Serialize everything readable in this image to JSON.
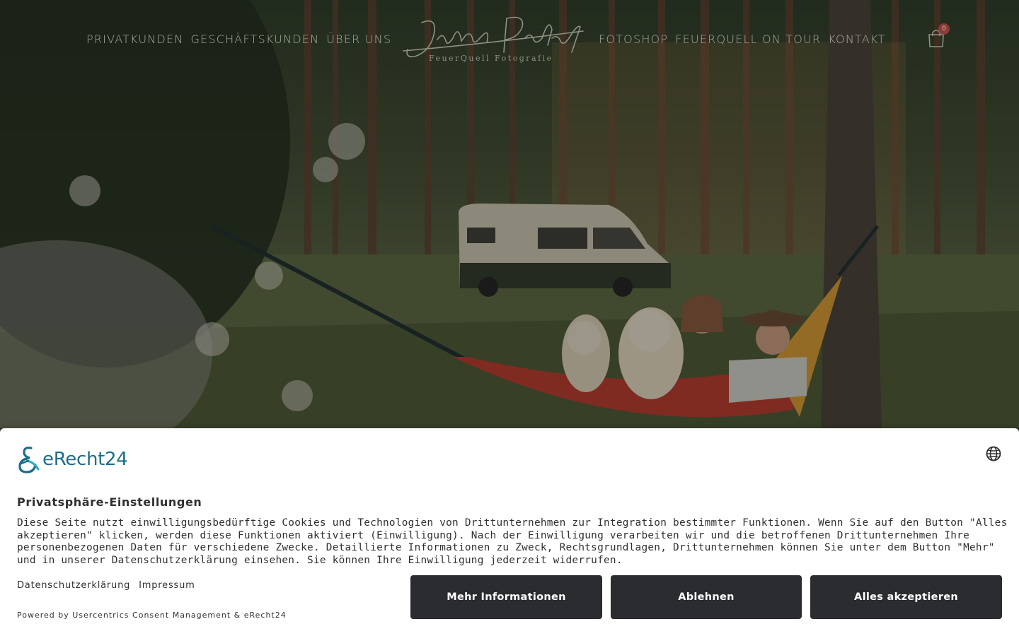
{
  "header": {
    "nav_left": [
      "PRIVATKUNDEN",
      "GESCHÄFTSKUNDEN",
      "ÜBER UNS"
    ],
    "nav_right": [
      "FOTOSHOP",
      "FEUERQUELL ON TOUR",
      "KONTAKT"
    ],
    "logo_subtitle": "FeuerQuell Fotografie",
    "cart_count": "0",
    "icons": {
      "cart": "shopping-bag-icon"
    }
  },
  "hero": {
    "image": "hammock-couple-dogs-campervan-forest-photo"
  },
  "consent": {
    "brand": "eRecht24",
    "title": "Privatsphäre-Einstellungen",
    "body": "Diese Seite nutzt einwilligungsbedürftige Cookies und Technologien von Drittunternehmen zur Integration bestimmter Funktionen. Wenn Sie auf den Button \"Alles akzeptieren\" klicken, werden diese Funktionen aktiviert (Einwilligung). Nach der Einwilligung verarbeiten wir und die betroffenen Drittunternehmen Ihre personenbezogenen Daten für verschiedene Zwecke. Detaillierte Informationen zu Zweck, Rechtsgrundlagen, Drittunternehmen können Sie unter dem Button \"Mehr\" und in unserer Datenschutzerklärung einsehen. Sie können Ihre Einwilligung jederzeit widerrufen.",
    "links": [
      "Datenschutzerklärung",
      "Impressum"
    ],
    "powered_by": "Powered by Usercentrics Consent Management & eRecht24",
    "buttons": {
      "more": "Mehr Informationen",
      "deny": "Ablehnen",
      "accept": "Alles akzeptieren"
    },
    "icons": {
      "language": "globe-icon",
      "brand": "erecht24-logo-icon"
    },
    "colors": {
      "button_bg": "#2a2c30",
      "brand": "#1d6e8a"
    }
  }
}
